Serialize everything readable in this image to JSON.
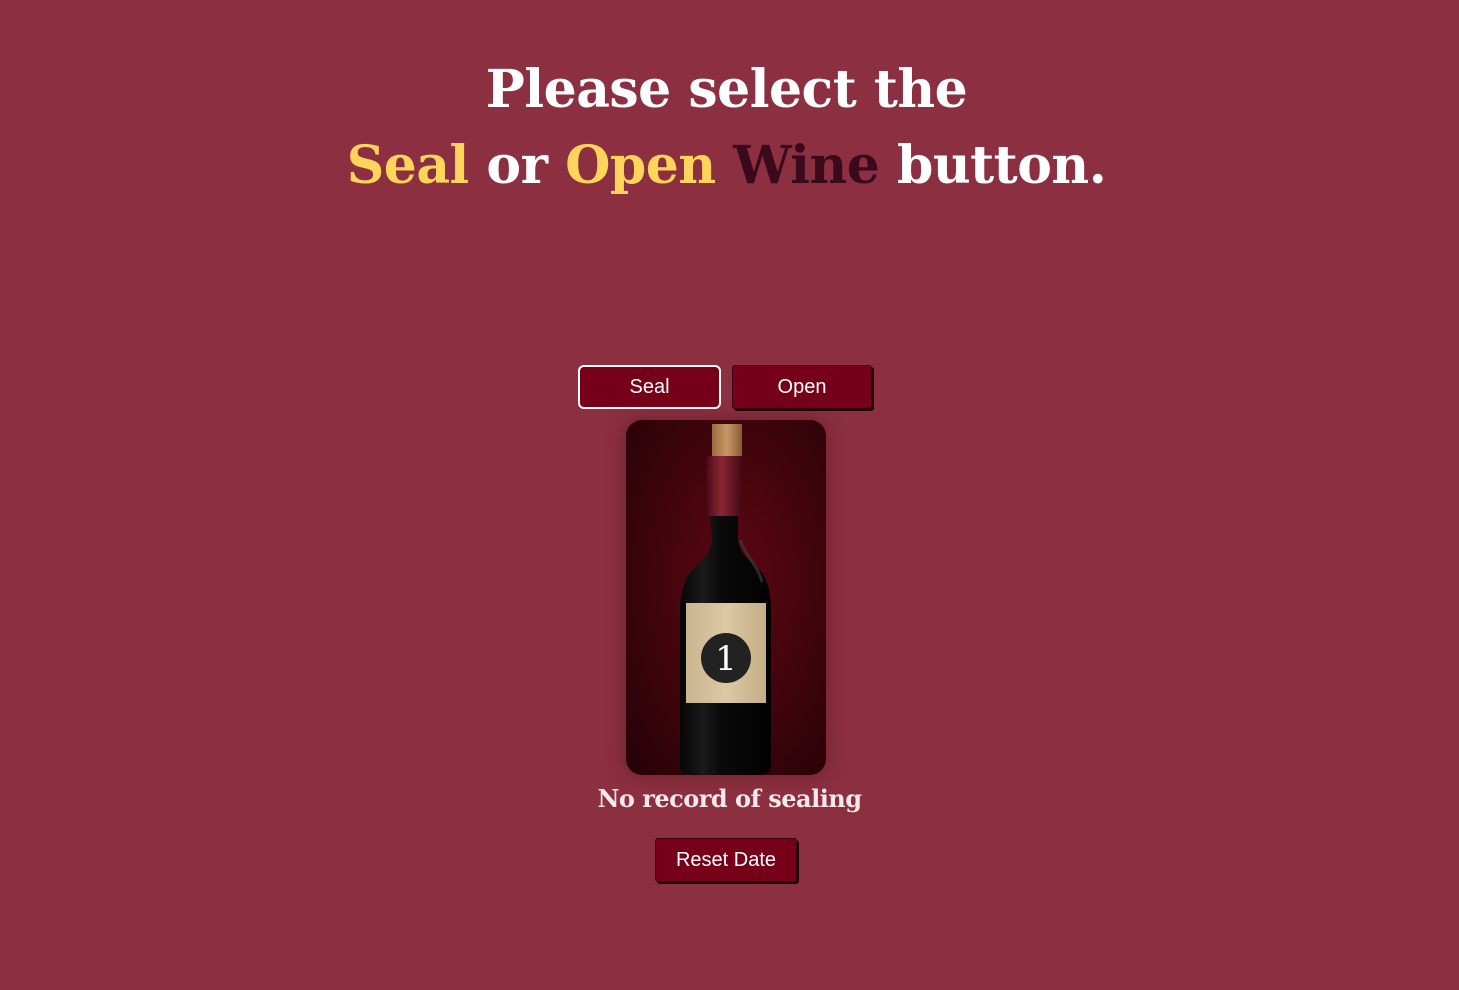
{
  "headline": {
    "line1": "Please select the",
    "word_seal": "Seal",
    "word_or": "or",
    "word_open": "Open",
    "word_wine": "Wine",
    "word_button": "button."
  },
  "buttons": {
    "seal_label": "Seal",
    "open_label": "Open",
    "reset_label": "Reset Date"
  },
  "bottle": {
    "label_number": "1",
    "icon": "wine-bottle-icon"
  },
  "status_text": "No record of sealing",
  "colors": {
    "background": "#8b2f41",
    "button": "#760019",
    "accent": "#ffd45a",
    "wine_word": "#3a0a1c"
  }
}
